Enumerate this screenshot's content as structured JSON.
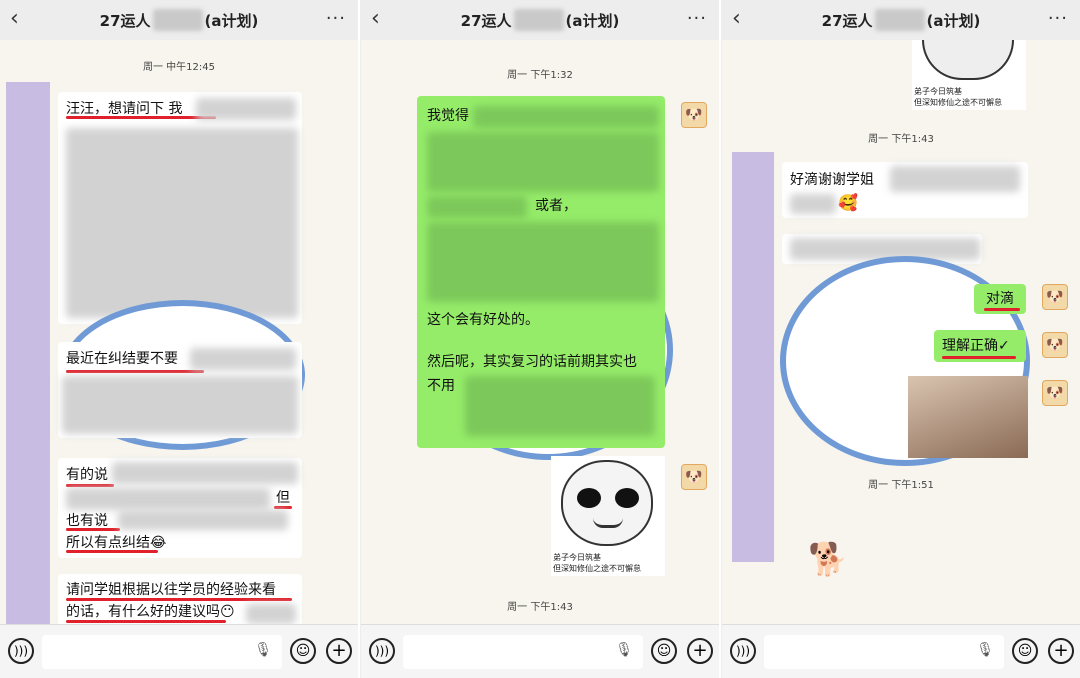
{
  "header": {
    "back_icon": "chevron-left-icon",
    "title_prefix": "27运人",
    "title_suffix": "(a计划)",
    "more_icon": "ellipsis-icon"
  },
  "panel1": {
    "time": "周一 中午12:45",
    "msg1": "汪汪，想请问下  我",
    "msg2": "最近在纠结要不要",
    "msg3_line1": "有的说",
    "msg3_but": "但",
    "msg3_line2": "也有说",
    "msg3_line3": "所以有点纠结😂",
    "msg4_line1": "请问学姐根据以往学员的经验来看",
    "msg4_line2": "的话，有什么好的建议吗😶"
  },
  "panel2": {
    "time1": "周一 下午1:32",
    "msg_line1": "我觉得",
    "msg_line2": "或者，",
    "msg_line3": "这个会有好处的。",
    "msg_line4": "然后呢，其实复习的话前期其实也",
    "msg_line5": "不用",
    "sticker_caption1": "弟子今日筑基",
    "sticker_caption2": "但深知修仙之途不可懈怠",
    "time2": "周一 下午1:43"
  },
  "panel3": {
    "sticker_caption1": "弟子今日筑基",
    "sticker_caption2": "但深知修仙之途不可懈怠",
    "time1": "周一 下午1:43",
    "msg1": "好滴谢谢学姐",
    "reply1": "对滴",
    "reply2": "理解正确✓",
    "time2": "周一 下午1:51"
  },
  "bottom": {
    "voice_icon": "voice-icon",
    "mic_icon": "mic-icon",
    "emoji_icon": "emoji-icon",
    "plus_icon": "plus-icon"
  }
}
